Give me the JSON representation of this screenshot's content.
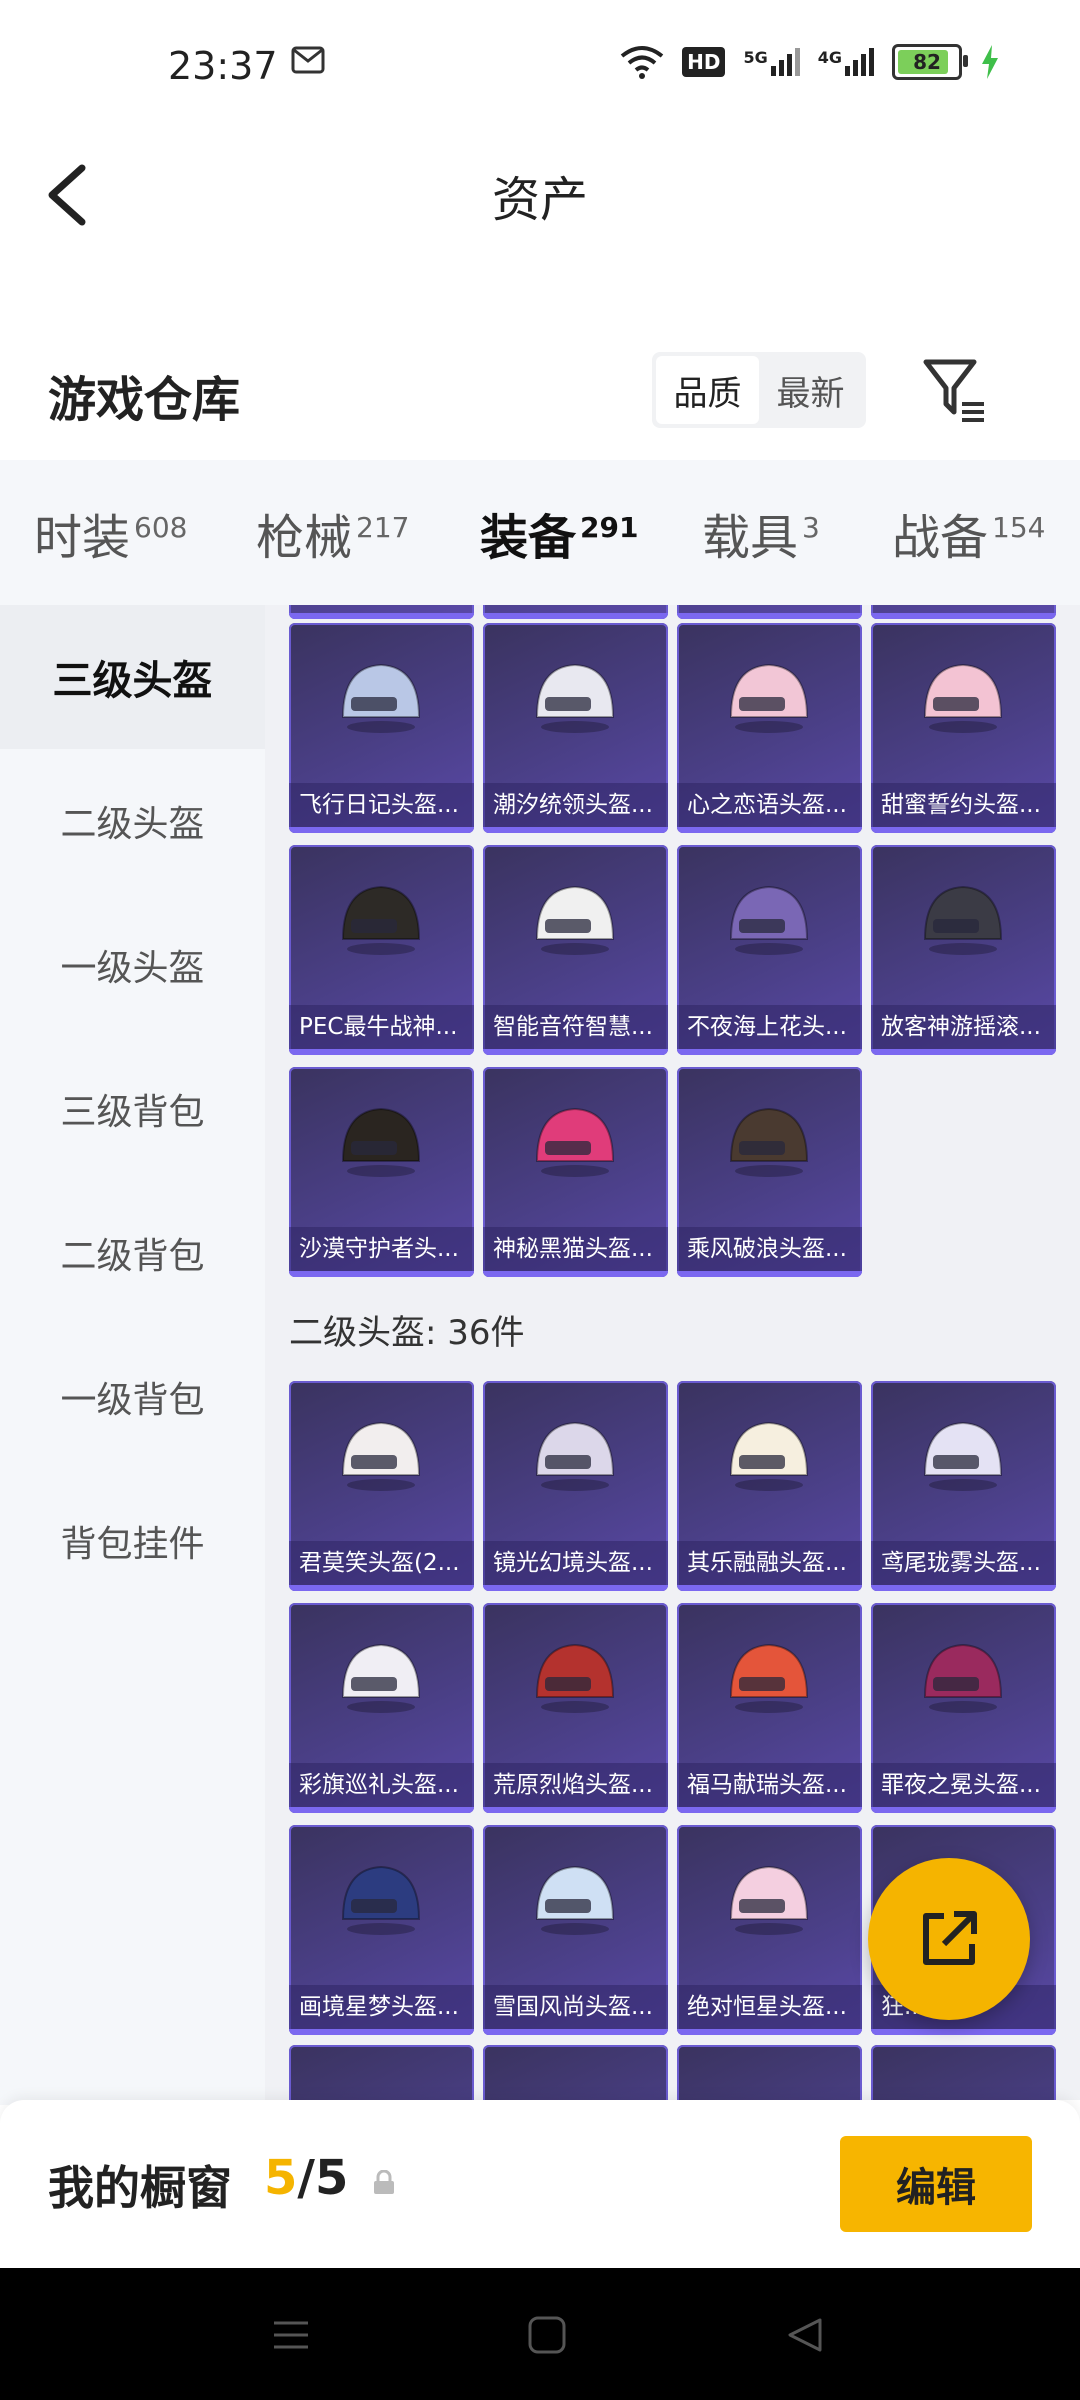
{
  "status_bar": {
    "time": "23:37",
    "signal_5g": "5G",
    "signal_4g": "4G",
    "hd_label": "HD",
    "battery": "82"
  },
  "header": {
    "title": "资产"
  },
  "warehouse": {
    "title": "游戏仓库",
    "sort_options": [
      "品质",
      "最新"
    ],
    "sort_selected": "品质"
  },
  "tabs": [
    {
      "label": "时装",
      "count": "608"
    },
    {
      "label": "枪械",
      "count": "217"
    },
    {
      "label": "装备",
      "count": "291",
      "active": true
    },
    {
      "label": "载具",
      "count": "3"
    },
    {
      "label": "战备",
      "count": "154"
    }
  ],
  "sidebar": {
    "items": [
      "三级头盔",
      "二级头盔",
      "一级头盔",
      "三级背包",
      "二级背包",
      "一级背包",
      "背包挂件"
    ],
    "active": "三级头盔"
  },
  "level3_items": [
    {
      "name": "飞行日记头盔...",
      "color": "#b9c7e6"
    },
    {
      "name": "潮汐统领头盔...",
      "color": "#e8e8f0"
    },
    {
      "name": "心之恋语头盔...",
      "color": "#f2c6d6"
    },
    {
      "name": "甜蜜誓约头盔...",
      "color": "#f3c3d3"
    },
    {
      "name": "PEC最牛战神...",
      "color": "#2d2a26"
    },
    {
      "name": "智能音符智慧...",
      "color": "#f0f0f0"
    },
    {
      "name": "不夜海上花头...",
      "color": "#7a67b5"
    },
    {
      "name": "放客神游摇滚...",
      "color": "#3b3b45"
    },
    {
      "name": "沙漠守护者头...",
      "color": "#2a2520"
    },
    {
      "name": "神秘黑猫头盔...",
      "color": "#e03c7a"
    },
    {
      "name": "乘风破浪头盔...",
      "color": "#4a3a30"
    }
  ],
  "level2_section": {
    "title": "二级头盔: 36件"
  },
  "level2_items": [
    {
      "name": "君莫笑头盔(2...",
      "color": "#f2eeee"
    },
    {
      "name": "镜光幻境头盔...",
      "color": "#dcd7ea"
    },
    {
      "name": "其乐融融头盔...",
      "color": "#f6efdf"
    },
    {
      "name": "鸢尾珑雾头盔...",
      "color": "#e4e2f4"
    },
    {
      "name": "彩旗巡礼头盔...",
      "color": "#f0eef4"
    },
    {
      "name": "荒原烈焰头盔...",
      "color": "#b4322e"
    },
    {
      "name": "福马献瑞头盔...",
      "color": "#e4553a"
    },
    {
      "name": "罪夜之冕头盔...",
      "color": "#9a2a5e"
    },
    {
      "name": "画境星梦头盔...",
      "color": "#2c3c80"
    },
    {
      "name": "雪国风尚头盔...",
      "color": "#cfe0f4"
    },
    {
      "name": "绝对恒星头盔...",
      "color": "#f4cfe0"
    },
    {
      "name": "狂...头盔",
      "color": "#3a3040"
    }
  ],
  "showcase": {
    "label": "我的橱窗",
    "current": "5",
    "separator": "/",
    "total": "5",
    "edit_label": "编辑"
  }
}
